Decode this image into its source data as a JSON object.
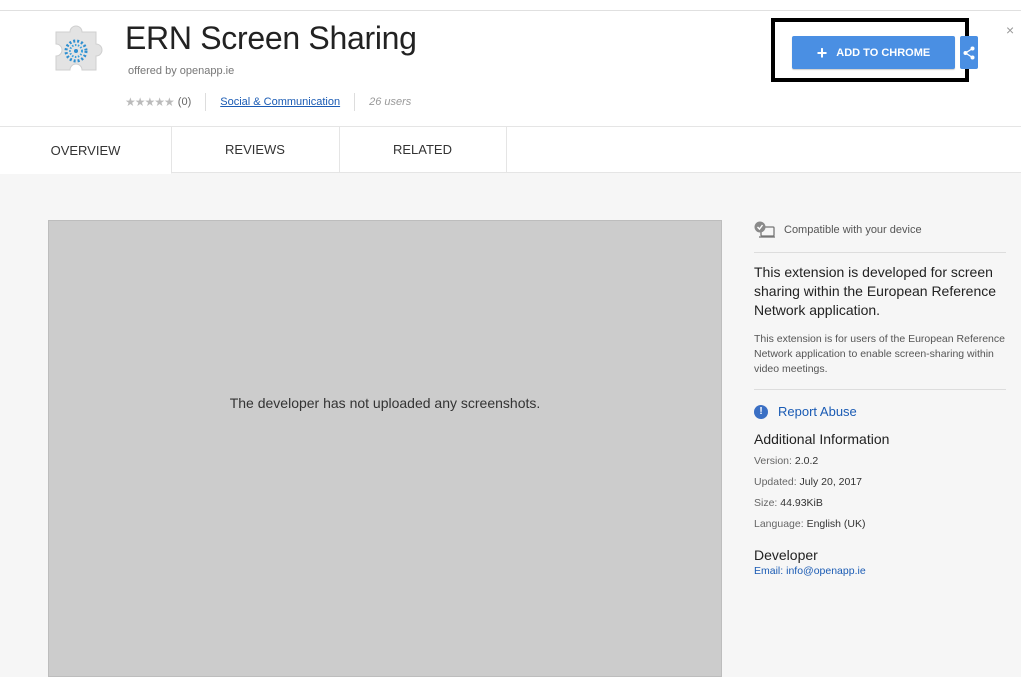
{
  "header": {
    "title": "ERN Screen Sharing",
    "offered_by": "offered by openapp.ie",
    "stars": "★★★★★",
    "rating_count": "(0)",
    "category": "Social & Communication",
    "users": "26 users"
  },
  "actions": {
    "add_label": "ADD TO CHROME",
    "plus": "+",
    "close": "×"
  },
  "tabs": [
    {
      "label": "OVERVIEW"
    },
    {
      "label": "REVIEWS"
    },
    {
      "label": "RELATED"
    }
  ],
  "screenshot_area": {
    "message": "The developer has not uploaded any screenshots."
  },
  "sidebar": {
    "compatible": "Compatible with your device",
    "lead": "This extension is developed for screen sharing within the European Reference Network application.",
    "description": "This extension is for users of the European Reference Network application to enable screen-sharing within video meetings.",
    "report": "Report Abuse",
    "additional_heading": "Additional Information",
    "version_label": "Version:",
    "version": "2.0.2",
    "updated_label": "Updated:",
    "updated": "July 20, 2017",
    "size_label": "Size:",
    "size": "44.93KiB",
    "language_label": "Language:",
    "language": "English (UK)",
    "developer_heading": "Developer",
    "email_label": "Email:",
    "email": "info@openapp.ie"
  },
  "colors": {
    "accent": "#4a8fe3",
    "link": "#1a5bb4",
    "highlight_box": "#000000"
  },
  "icons": {
    "extension": "puzzle-piece-icon",
    "share": "share-icon",
    "compatible": "device-check-icon",
    "report": "exclamation-icon"
  }
}
